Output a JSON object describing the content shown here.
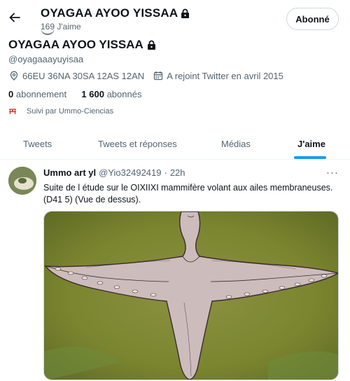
{
  "header": {
    "back_icon": "arrow-left-icon",
    "title": "OYAGAA AYOO YISSAA",
    "subtitle": "169 J'aime",
    "follow_button": "Abonné"
  },
  "profile": {
    "name": "OYAGAA AYOO YISSAA",
    "handle": "@oyagaaayuyisaa",
    "location": "66EU 36NA 30SA 12AS 12AN",
    "joined": "A rejoint Twitter en avril 2015",
    "following_count": "0",
    "following_label": "abonnement",
    "followers_count": "1 600",
    "followers_label": "abonnés",
    "followed_by": "Suivi par Ummo-Ciencias"
  },
  "tabs": [
    {
      "label": "Tweets"
    },
    {
      "label": "Tweets et réponses"
    },
    {
      "label": "Médias"
    },
    {
      "label": "J'aime",
      "active": true
    }
  ],
  "tweet": {
    "author": "Ummo art yl",
    "handle": "@Yio32492419",
    "separator": "·",
    "time": "22h",
    "text": "Suite de l étude sur le OIXIIXI mammifère volant aux ailes membraneuses. (D41 5) (Vue de dessus).",
    "more_icon": "···"
  },
  "colors": {
    "accent": "#1d9bf0",
    "text": "#0f1419",
    "muted": "#536471",
    "media_bg": "#7f8a3a",
    "creature": "#cfc0bf"
  }
}
